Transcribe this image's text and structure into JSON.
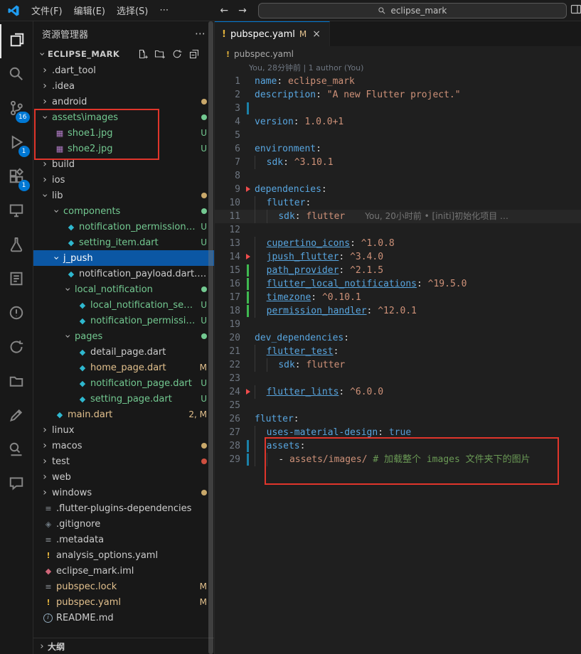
{
  "colors": {
    "accent_blue": "#0078d4",
    "selection_blue": "#0b57a4",
    "untracked_green": "#73c991",
    "modified_gold": "#e2c08d",
    "error_red": "#f14c4c",
    "annotation_red": "#e0352b",
    "git_add_green": "#3fb950",
    "git_mod_blue": "#1b81a8",
    "git_del_red": "#f14c4c",
    "key_blue": "#58a6e0",
    "value_orange": "#ce9178",
    "comment_green": "#6a9955",
    "dart_teal": "#2fb8cf"
  },
  "titlebar": {
    "menus": [
      "文件(F)",
      "编辑(E)",
      "选择(S)",
      "⋯"
    ],
    "back_arrow": "←",
    "forward_arrow": "→",
    "search_value": "eclipse_mark"
  },
  "activity_bar": {
    "items": [
      {
        "name": "explorer",
        "active": true
      },
      {
        "name": "search"
      },
      {
        "name": "source-control",
        "badge": "16"
      },
      {
        "name": "run-debug",
        "badge": "1"
      },
      {
        "name": "extensions",
        "badge": "1"
      },
      {
        "name": "remote-explorer"
      },
      {
        "name": "testing"
      },
      {
        "name": "notebook"
      },
      {
        "name": "java-project"
      },
      {
        "name": "sync"
      },
      {
        "name": "project-manager"
      },
      {
        "name": "snippets"
      },
      {
        "name": "search-editor"
      },
      {
        "name": "comments"
      }
    ]
  },
  "sidebar": {
    "title": "资源管理器",
    "section": "ECLIPSE_MARK",
    "outline_label": "大纲",
    "tree": [
      {
        "label": ".dart_tool",
        "depth": 0,
        "kind": "folder",
        "open": false
      },
      {
        "label": ".idea",
        "depth": 0,
        "kind": "folder",
        "open": false
      },
      {
        "label": "android",
        "depth": 0,
        "kind": "folder",
        "open": false,
        "dot": "gold"
      },
      {
        "label": "assets\\images",
        "depth": 0,
        "kind": "folder",
        "open": true,
        "state": "untracked",
        "dot": "green"
      },
      {
        "label": "shoe1.jpg",
        "depth": 1,
        "kind": "file",
        "icon": "image",
        "state": "untracked",
        "badge": "U"
      },
      {
        "label": "shoe2.jpg",
        "depth": 1,
        "kind": "file",
        "icon": "image",
        "state": "untracked",
        "badge": "U"
      },
      {
        "label": "build",
        "depth": 0,
        "kind": "folder",
        "open": false
      },
      {
        "label": "ios",
        "depth": 0,
        "kind": "folder",
        "open": false
      },
      {
        "label": "lib",
        "depth": 0,
        "kind": "folder",
        "open": true,
        "dot": "gold"
      },
      {
        "label": "components",
        "depth": 1,
        "kind": "folder",
        "open": true,
        "state": "untracked",
        "dot": "green"
      },
      {
        "label": "notification_permission_item…",
        "depth": 2,
        "kind": "file",
        "icon": "dart",
        "state": "untracked",
        "badge": "U"
      },
      {
        "label": "setting_item.dart",
        "depth": 2,
        "kind": "file",
        "icon": "dart",
        "state": "untracked",
        "badge": "U"
      },
      {
        "label": "j_push",
        "depth": 1,
        "kind": "folder",
        "open": true,
        "selected": true
      },
      {
        "label": "notification_payload.dart.dart",
        "depth": 2,
        "kind": "file",
        "icon": "dart"
      },
      {
        "label": "local_notification",
        "depth": 2,
        "kind": "folder",
        "open": true,
        "state": "untracked",
        "dot": "green"
      },
      {
        "label": "local_notification_service.dart",
        "depth": 3,
        "kind": "file",
        "icon": "dart",
        "state": "untracked",
        "badge": "U"
      },
      {
        "label": "notification_permission_util.…",
        "depth": 3,
        "kind": "file",
        "icon": "dart",
        "state": "untracked",
        "badge": "U"
      },
      {
        "label": "pages",
        "depth": 2,
        "kind": "folder",
        "open": true,
        "state": "untracked",
        "dot": "green"
      },
      {
        "label": "detail_page.dart",
        "depth": 3,
        "kind": "file",
        "icon": "dart"
      },
      {
        "label": "home_page.dart",
        "depth": 3,
        "kind": "file",
        "icon": "dart",
        "state": "modified",
        "badge": "M"
      },
      {
        "label": "notification_page.dart",
        "depth": 3,
        "kind": "file",
        "icon": "dart",
        "state": "untracked",
        "badge": "U"
      },
      {
        "label": "setting_page.dart",
        "depth": 3,
        "kind": "file",
        "icon": "dart",
        "state": "untracked",
        "badge": "U"
      },
      {
        "label": "main.dart",
        "depth": 1,
        "kind": "file",
        "icon": "dart",
        "state": "modified",
        "badge": "2, M"
      },
      {
        "label": "linux",
        "depth": 0,
        "kind": "folder",
        "open": false
      },
      {
        "label": "macos",
        "depth": 0,
        "kind": "folder",
        "open": false,
        "dot": "gold"
      },
      {
        "label": "test",
        "depth": 0,
        "kind": "folder",
        "open": false,
        "dot": "red"
      },
      {
        "label": "web",
        "depth": 0,
        "kind": "folder",
        "open": false
      },
      {
        "label": "windows",
        "depth": 0,
        "kind": "folder",
        "open": false,
        "dot": "gold"
      },
      {
        "label": ".flutter-plugins-dependencies",
        "depth": 0,
        "kind": "file",
        "icon": "doc"
      },
      {
        "label": ".gitignore",
        "depth": 0,
        "kind": "file",
        "icon": "git"
      },
      {
        "label": ".metadata",
        "depth": 0,
        "kind": "file",
        "icon": "doc"
      },
      {
        "label": "analysis_options.yaml",
        "depth": 0,
        "kind": "file",
        "icon": "yaml"
      },
      {
        "label": "eclipse_mark.iml",
        "depth": 0,
        "kind": "file",
        "icon": "iml"
      },
      {
        "label": "pubspec.lock",
        "depth": 0,
        "kind": "file",
        "icon": "lock",
        "state": "modified",
        "badge": "M"
      },
      {
        "label": "pubspec.yaml",
        "depth": 0,
        "kind": "file",
        "icon": "yaml",
        "state": "modified",
        "badge": "M"
      },
      {
        "label": "README.md",
        "depth": 0,
        "kind": "file",
        "icon": "info"
      }
    ]
  },
  "editor": {
    "tab": {
      "warn_icon": "!",
      "label": "pubspec.yaml",
      "modified": "M",
      "close": "×"
    },
    "breadcrumb": {
      "warn_icon": "!",
      "file": "pubspec.yaml"
    },
    "blame_header": "You, 28分钟前 | 1 author (You)",
    "lines": [
      {
        "n": 1,
        "ind": 0,
        "segs": [
          [
            "k",
            "name"
          ],
          [
            "p",
            ": "
          ],
          [
            "v",
            "eclipse_mark"
          ]
        ]
      },
      {
        "n": 2,
        "ind": 0,
        "segs": [
          [
            "k",
            "description"
          ],
          [
            "p",
            ": "
          ],
          [
            "v",
            "\"A new Flutter project.\""
          ]
        ]
      },
      {
        "n": 3,
        "ind": 0,
        "git": "mod",
        "segs": []
      },
      {
        "n": 4,
        "ind": 0,
        "segs": [
          [
            "k",
            "version"
          ],
          [
            "p",
            ": "
          ],
          [
            "v",
            "1.0.0+1"
          ]
        ]
      },
      {
        "n": 5,
        "ind": 0,
        "segs": []
      },
      {
        "n": 6,
        "ind": 0,
        "segs": [
          [
            "k",
            "environment"
          ],
          [
            "p",
            ":"
          ]
        ]
      },
      {
        "n": 7,
        "ind": 1,
        "segs": [
          [
            "k",
            "sdk"
          ],
          [
            "p",
            ": "
          ],
          [
            "v",
            "^3.10.1"
          ]
        ]
      },
      {
        "n": 8,
        "ind": 0,
        "segs": []
      },
      {
        "n": 9,
        "ind": 0,
        "git": "del",
        "segs": [
          [
            "k",
            "dependencies"
          ],
          [
            "p",
            ":"
          ]
        ]
      },
      {
        "n": 10,
        "ind": 1,
        "segs": [
          [
            "k",
            "flutter"
          ],
          [
            "p",
            ":"
          ]
        ]
      },
      {
        "n": 11,
        "ind": 2,
        "cur": true,
        "segs": [
          [
            "k",
            "sdk"
          ],
          [
            "p",
            ": "
          ],
          [
            "v",
            "flutter"
          ],
          [
            "g",
            "You, 20小时前 • [initi]初始化项目 …"
          ]
        ]
      },
      {
        "n": 12,
        "ind": 0,
        "segs": []
      },
      {
        "n": 13,
        "ind": 1,
        "segs": [
          [
            "ku",
            "cupertino_icons"
          ],
          [
            "p",
            ": "
          ],
          [
            "v",
            "^1.0.8"
          ]
        ]
      },
      {
        "n": 14,
        "ind": 1,
        "git": "del",
        "segs": [
          [
            "ku",
            "jpush_flutter"
          ],
          [
            "p",
            ": "
          ],
          [
            "v",
            "^3.4.0"
          ]
        ]
      },
      {
        "n": 15,
        "ind": 1,
        "git": "add",
        "segs": [
          [
            "ku",
            "path_provider"
          ],
          [
            "p",
            ": "
          ],
          [
            "v",
            "^2.1.5"
          ]
        ]
      },
      {
        "n": 16,
        "ind": 1,
        "git": "add",
        "segs": [
          [
            "ku",
            "flutter_local_notifications"
          ],
          [
            "p",
            ": "
          ],
          [
            "v",
            "^19.5.0"
          ]
        ]
      },
      {
        "n": 17,
        "ind": 1,
        "git": "add",
        "segs": [
          [
            "ku",
            "timezone"
          ],
          [
            "p",
            ": "
          ],
          [
            "v",
            "^0.10.1"
          ]
        ]
      },
      {
        "n": 18,
        "ind": 1,
        "git": "add",
        "segs": [
          [
            "ku",
            "permission_handler"
          ],
          [
            "p",
            ": "
          ],
          [
            "v",
            "^12.0.1"
          ]
        ]
      },
      {
        "n": 19,
        "ind": 0,
        "segs": []
      },
      {
        "n": 20,
        "ind": 0,
        "segs": [
          [
            "k",
            "dev_dependencies"
          ],
          [
            "p",
            ":"
          ]
        ]
      },
      {
        "n": 21,
        "ind": 1,
        "segs": [
          [
            "ku",
            "flutter_test"
          ],
          [
            "p",
            ":"
          ]
        ]
      },
      {
        "n": 22,
        "ind": 2,
        "segs": [
          [
            "k",
            "sdk"
          ],
          [
            "p",
            ": "
          ],
          [
            "v",
            "flutter"
          ]
        ]
      },
      {
        "n": 23,
        "ind": 0,
        "segs": []
      },
      {
        "n": 24,
        "ind": 1,
        "git": "del",
        "segs": [
          [
            "ku",
            "flutter_lints"
          ],
          [
            "p",
            ": "
          ],
          [
            "v",
            "^6.0.0"
          ]
        ]
      },
      {
        "n": 25,
        "ind": 0,
        "segs": []
      },
      {
        "n": 26,
        "ind": 0,
        "segs": [
          [
            "k",
            "flutter"
          ],
          [
            "p",
            ":"
          ]
        ]
      },
      {
        "n": 27,
        "ind": 1,
        "segs": [
          [
            "k",
            "uses-material-design"
          ],
          [
            "p",
            ": "
          ],
          [
            "b",
            "true"
          ]
        ]
      },
      {
        "n": 28,
        "ind": 1,
        "git": "mod",
        "segs": [
          [
            "k",
            "assets"
          ],
          [
            "p",
            ":"
          ]
        ]
      },
      {
        "n": 29,
        "ind": 2,
        "git": "mod",
        "segs": [
          [
            "p",
            "- "
          ],
          [
            "v",
            "assets/images/ "
          ],
          [
            "c",
            "# 加载整个 images 文件夹下的图片"
          ]
        ]
      }
    ]
  }
}
